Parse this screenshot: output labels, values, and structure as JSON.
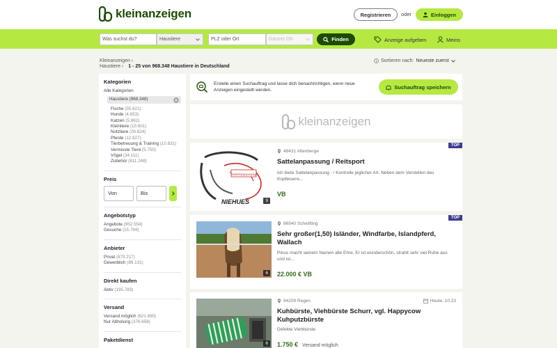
{
  "header": {
    "logo_text": "kleinanzeigen",
    "register_label": "Registrieren",
    "or_text": "oder",
    "login_label": "Einloggen"
  },
  "search": {
    "query_placeholder": "Was suchst du?",
    "category_value": "Haustiere",
    "location_placeholder": "PLZ oder Ort",
    "radius_value": "Ganzer Ort",
    "find_label": "Finden",
    "post_ad_label": "Anzeige aufgeben",
    "mine_label": "Meins"
  },
  "breadcrumb": {
    "root": "Kleinanzeigen",
    "current": "Haustiere",
    "result_summary": "1 - 25 von 968.348 Haustiere in Deutschland"
  },
  "sort": {
    "label": "Sortieren nach:",
    "value": "Neueste zuerst"
  },
  "sidebar": {
    "categories_title": "Kategorien",
    "all_categories": "Alle Kategorien",
    "selected_category": "Haustiere (968.348)",
    "subcategories": [
      {
        "name": "Fische",
        "count": "(55.621)"
      },
      {
        "name": "Hunde",
        "count": "(4.653)"
      },
      {
        "name": "Katzen",
        "count": "(5.862)"
      },
      {
        "name": "Kleintiere",
        "count": "(10.601)"
      },
      {
        "name": "Nutztiere",
        "count": "(26.624)"
      },
      {
        "name": "Pferde",
        "count": "(12.827)"
      },
      {
        "name": "Tierbetreuung & Training",
        "count": "(10.831)"
      },
      {
        "name": "Vermisste Tiere",
        "count": "(5.750)"
      },
      {
        "name": "Vögel",
        "count": "(34.111)"
      },
      {
        "name": "Zubehör",
        "count": "(811.248)"
      }
    ],
    "price_title": "Preis",
    "price_from": "Von",
    "price_to": "Bis",
    "offer_type_title": "Angebotstyp",
    "offer_types": [
      {
        "name": "Angebote",
        "count": "(952.554)"
      },
      {
        "name": "Gesuche",
        "count": "(15.794)"
      }
    ],
    "seller_title": "Anbieter",
    "sellers": [
      {
        "name": "Privat",
        "count": "(879.217)"
      },
      {
        "name": "Gewerblich",
        "count": "(89.131)"
      }
    ],
    "direct_buy_title": "Direkt kaufen",
    "direct_buy": [
      {
        "name": "Aktiv",
        "count": "(195.783)"
      }
    ],
    "shipping_title": "Versand",
    "shipping": [
      {
        "name": "Versand möglich",
        "count": "(621.690)"
      },
      {
        "name": "Nur Abholung",
        "count": "(376.656)"
      }
    ],
    "parcel_title": "Paketdienst"
  },
  "alert": {
    "text": "Erstelle einen Suchauftrag und lasse dich benachrichtigen, wenn neue Anzeigen eingestellt werden.",
    "button_label": "Suchauftrag speichern"
  },
  "banner": {
    "text": "kleinanzeigen"
  },
  "listings": [
    {
      "location": "48431 Altenberge",
      "date": "",
      "title": "Sattelanpassung / Reitsport",
      "description": "Ich biete Sattelanpassung - / Kontrolle jeglicher Art. Neben dem Verstellen des Kopfeisens...",
      "price": "VB",
      "shipping": "",
      "image_count": "9",
      "top_badge": "TOP",
      "image_caption": "NIEHUES",
      "image_badge_text": "Sattelanpassung"
    },
    {
      "location": "86940 Schwifting",
      "date": "",
      "title": "Sehr großer(1,50) Isländer, Windfarbe, Islandpferd, Wallach",
      "description": "Pinus macht seinem Namen alle Ehre. Er ist wunderschön, strahlt sehr viel Ruhe aus und ist...",
      "price": "22.000 € VB",
      "shipping": "",
      "image_count": "6",
      "top_badge": "TOP"
    },
    {
      "location": "94209 Regen",
      "date": "Heute, 10:23",
      "title": "Kuhbürste, Viehbürste Schurr, vgl. Happycow Kuhputzbürste",
      "description": "Defekte Viehbürste",
      "price": "1.750 €",
      "shipping": "Versand möglich",
      "image_count": "6",
      "top_badge": ""
    }
  ],
  "colors": {
    "brand_green": "#b5e941",
    "dark_green": "#1d4b00",
    "price_green": "#326916",
    "top_badge": "#3c3c8f"
  }
}
